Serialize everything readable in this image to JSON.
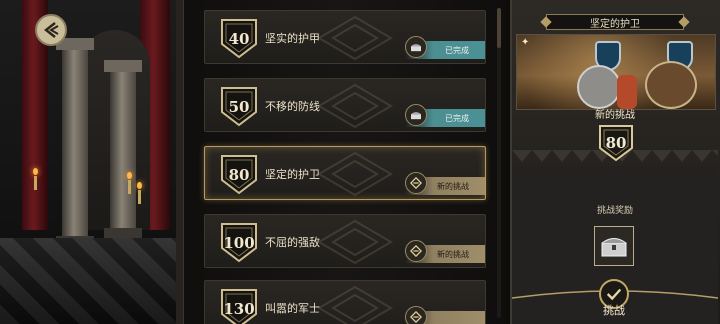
{
  "challenges": [
    {
      "level": "40",
      "title": "坚实的护甲",
      "status": "已完成",
      "state": "done"
    },
    {
      "level": "50",
      "title": "不移的防线",
      "status": "已完成",
      "state": "done"
    },
    {
      "level": "80",
      "title": "坚定的护卫",
      "status": "新的挑战",
      "state": "new"
    },
    {
      "level": "100",
      "title": "不屈的强敌",
      "status": "新的挑战",
      "state": "new"
    },
    {
      "level": "130",
      "title": "叫嚣的军士",
      "status": "",
      "state": "new"
    }
  ],
  "detail": {
    "title": "坚定的护卫",
    "new_label": "新的挑战",
    "level": "80",
    "reward_label": "挑战奖励",
    "challenge_button": "挑战"
  },
  "colors": {
    "done_status": "#4a9095",
    "new_status": "#a08e6a",
    "accent_gold": "#c2a865"
  },
  "icons": {
    "back": "back-arrow-icon",
    "status_done": "chest-icon",
    "status_new": "scroll-icon",
    "reward": "treasure-chest-icon",
    "challenge": "checkmark-icon"
  }
}
